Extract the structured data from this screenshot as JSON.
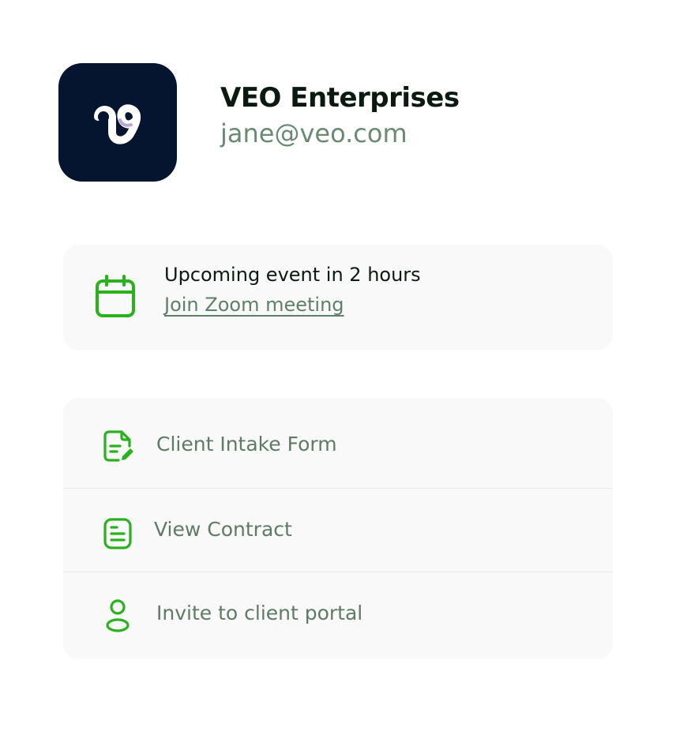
{
  "company": {
    "name": "VEO Enterprises",
    "email": "jane@veo.com"
  },
  "event": {
    "title": "Upcoming event in 2 hours",
    "link_label": "Join Zoom meeting",
    "icon": "calendar-icon"
  },
  "actions": [
    {
      "label": "Client Intake Form",
      "icon": "edit-document-icon"
    },
    {
      "label": "View Contract",
      "icon": "document-icon"
    },
    {
      "label": "Invite to client portal",
      "icon": "user-icon"
    }
  ],
  "colors": {
    "logo_background": "#06152f",
    "accent_green": "#2ab11e",
    "muted_text": "#5f7a66"
  }
}
